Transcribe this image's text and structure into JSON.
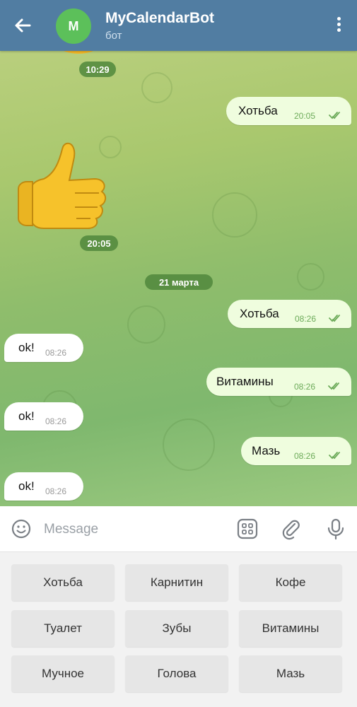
{
  "header": {
    "title": "MyCalendarBot",
    "subtitle": "бот",
    "avatar_letter": "M"
  },
  "chat": {
    "times": {
      "sticker1": "10:29",
      "sticker2": "20:05"
    },
    "date_chip": "21 марта",
    "messages": [
      {
        "dir": "out",
        "text": "Хотьба",
        "time": "20:05"
      },
      {
        "dir": "out",
        "text": "Хотьба",
        "time": "08:26"
      },
      {
        "dir": "in",
        "text": "ok!",
        "time": "08:26"
      },
      {
        "dir": "out",
        "text": "Витамины",
        "time": "08:26"
      },
      {
        "dir": "in",
        "text": "ok!",
        "time": "08:26"
      },
      {
        "dir": "out",
        "text": "Мазь",
        "time": "08:26"
      },
      {
        "dir": "in",
        "text": "ok!",
        "time": "08:26"
      }
    ]
  },
  "input": {
    "placeholder": "Message",
    "icons": [
      "emoji-icon",
      "bot-commands-icon",
      "attach-icon",
      "microphone-icon"
    ]
  },
  "keyboard": {
    "rows": [
      [
        "Хотьба",
        "Карнитин",
        "Кофе"
      ],
      [
        "Туалет",
        "Зубы",
        "Витамины"
      ],
      [
        "Мучное",
        "Голова",
        "Мазь"
      ]
    ]
  },
  "colors": {
    "header": "#517da2",
    "outgoing_bubble": "#effdde",
    "incoming_bubble": "#ffffff",
    "avatar": "#5cc05a",
    "chat_bg": "#9cc477"
  }
}
